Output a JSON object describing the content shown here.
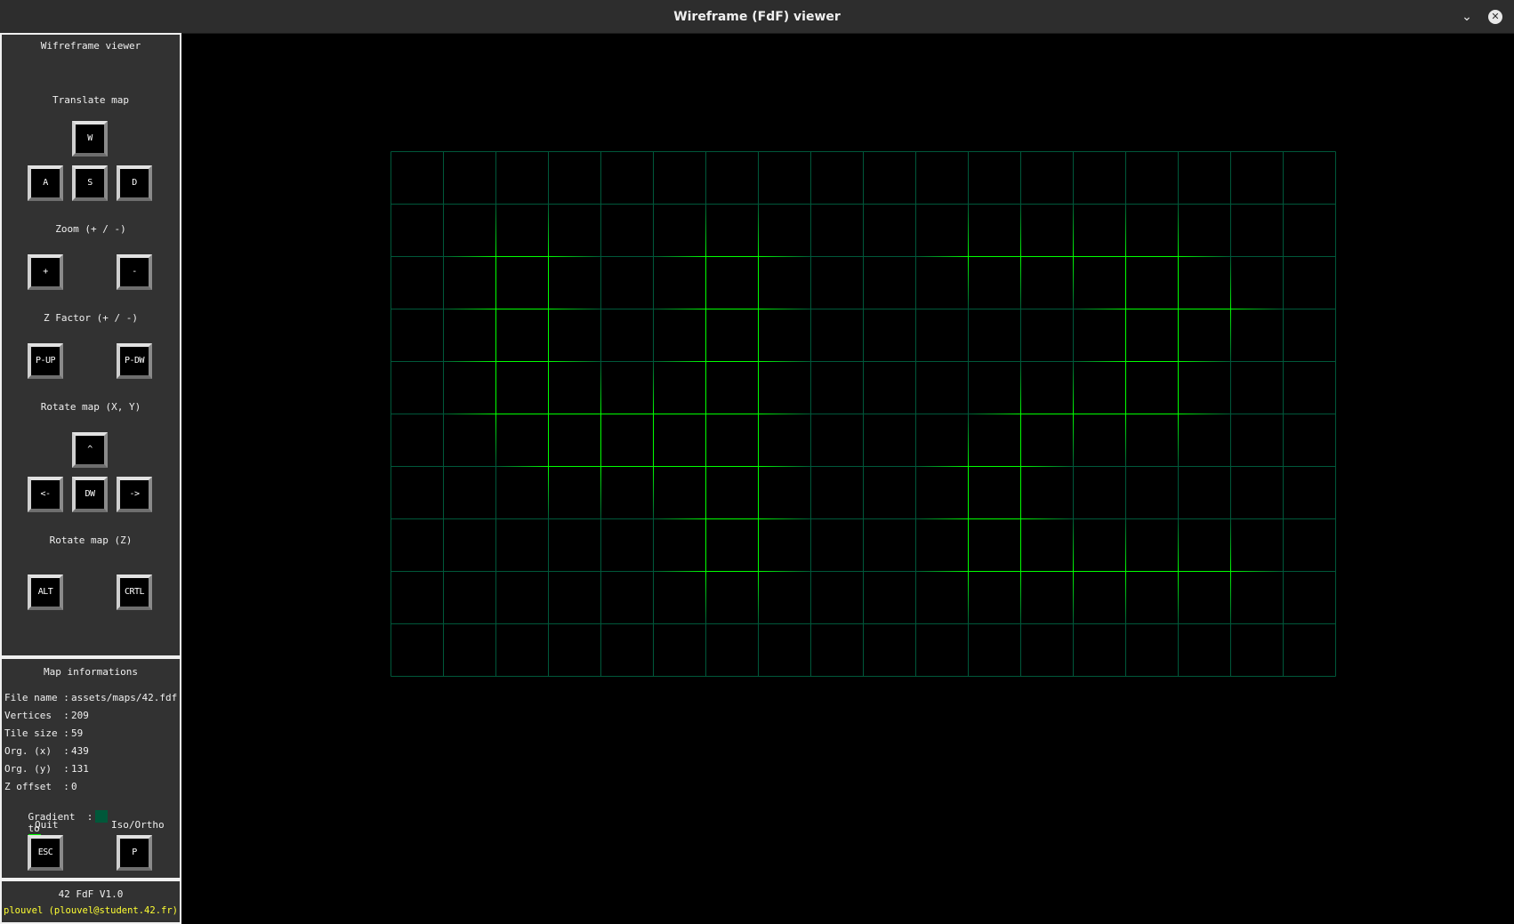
{
  "window": {
    "title": "Wireframe (FdF) viewer",
    "minimize_glyph": "⌄",
    "close_glyph": "✕"
  },
  "controls": {
    "header": "Wifreframe viewer",
    "translate": {
      "label": "Translate map",
      "up": "W",
      "left": "A",
      "down": "S",
      "right": "D"
    },
    "zoom": {
      "label": "Zoom (+ / -)",
      "in": "+",
      "out": "-"
    },
    "zfactor": {
      "label": "Z Factor (+ / -)",
      "up": "P-UP",
      "down": "P-DW"
    },
    "rotate_xy": {
      "label": "Rotate map (X, Y)",
      "up": "^",
      "left": "<-",
      "down": "DW",
      "right": "->"
    },
    "rotate_z": {
      "label": "Rotate map (Z)",
      "alt": "ALT",
      "ctrl": "CRTL"
    }
  },
  "info": {
    "header": "Map informations",
    "rows": [
      {
        "label": "File name :",
        "value": "assets/maps/42.fdf"
      },
      {
        "label": "Vertices  :",
        "value": "209"
      },
      {
        "label": "Tile size :",
        "value": "59"
      },
      {
        "label": "Org. (x)  :",
        "value": "439"
      },
      {
        "label": "Org. (y)  :",
        "value": "131"
      },
      {
        "label": "Z offset  :",
        "value": "0"
      }
    ],
    "gradient": {
      "label": "Gradient  :",
      "to": "to",
      "from_color": "#00583a",
      "to_color": "#00ff00"
    },
    "quit": {
      "label": "Quit",
      "key": "ESC"
    },
    "projection": {
      "label": "Iso/Ortho",
      "key": "P"
    }
  },
  "footer": {
    "version": "42 FdF V1.0",
    "author": "plouvel (plouvel@student.42.fr)"
  },
  "map": {
    "file": "42.fdf",
    "heights": [
      [
        0,
        0,
        0,
        0,
        0,
        0,
        0,
        0,
        0,
        0,
        0,
        0,
        0,
        0,
        0,
        0,
        0,
        0,
        0
      ],
      [
        0,
        0,
        0,
        0,
        0,
        0,
        0,
        0,
        0,
        0,
        0,
        0,
        0,
        0,
        0,
        0,
        0,
        0,
        0
      ],
      [
        0,
        0,
        10,
        10,
        0,
        0,
        10,
        10,
        0,
        0,
        0,
        10,
        10,
        10,
        10,
        10,
        0,
        0,
        0
      ],
      [
        0,
        0,
        10,
        10,
        0,
        0,
        10,
        10,
        0,
        0,
        0,
        0,
        0,
        0,
        10,
        10,
        10,
        0,
        0
      ],
      [
        0,
        0,
        10,
        10,
        0,
        0,
        10,
        10,
        0,
        0,
        0,
        0,
        0,
        0,
        10,
        10,
        0,
        0,
        0
      ],
      [
        0,
        0,
        10,
        10,
        10,
        10,
        10,
        10,
        0,
        0,
        0,
        0,
        10,
        10,
        10,
        10,
        0,
        0,
        0
      ],
      [
        0,
        0,
        0,
        10,
        10,
        10,
        10,
        10,
        0,
        0,
        0,
        10,
        10,
        0,
        0,
        0,
        0,
        0,
        0
      ],
      [
        0,
        0,
        0,
        0,
        0,
        0,
        10,
        10,
        0,
        0,
        0,
        10,
        10,
        0,
        0,
        0,
        0,
        0,
        0
      ],
      [
        0,
        0,
        0,
        0,
        0,
        0,
        10,
        10,
        0,
        0,
        0,
        10,
        10,
        10,
        10,
        10,
        10,
        0,
        0
      ],
      [
        0,
        0,
        0,
        0,
        0,
        0,
        0,
        0,
        0,
        0,
        0,
        0,
        0,
        0,
        0,
        0,
        0,
        0,
        0
      ],
      [
        0,
        0,
        0,
        0,
        0,
        0,
        0,
        0,
        0,
        0,
        0,
        0,
        0,
        0,
        0,
        0,
        0,
        0,
        0
      ]
    ]
  }
}
